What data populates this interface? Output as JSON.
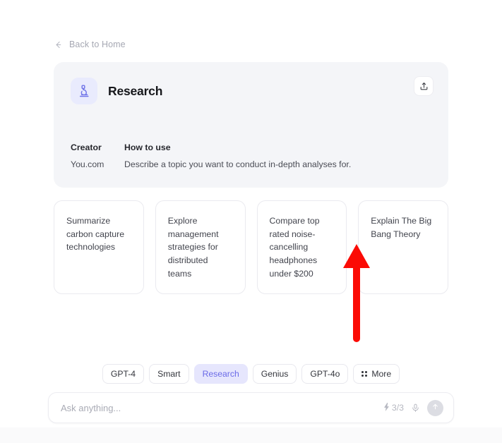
{
  "nav": {
    "back_label": "Back to Home",
    "back_icon": "arrow-left-icon"
  },
  "header": {
    "title": "Research",
    "app_icon": "microscope-icon",
    "share_icon": "share-upload-icon",
    "icon_bg": "#e9ebfd",
    "icon_color": "#6f73e8",
    "card_bg": "#f4f5f8"
  },
  "meta": {
    "creator_label": "Creator",
    "creator_value": "You.com",
    "howto_label": "How to use",
    "howto_value": "Describe a topic you want to conduct in-depth analyses for."
  },
  "suggestions": [
    {
      "text": "Summarize carbon capture technologies"
    },
    {
      "text": "Explore management strategies for distributed teams"
    },
    {
      "text": "Compare top rated noise-cancelling headphones under $200"
    },
    {
      "text": "Explain The Big Bang Theory"
    }
  ],
  "annotation": {
    "type": "arrow-up",
    "color": "#fb0b05"
  },
  "modes": [
    {
      "label": "GPT-4",
      "active": false
    },
    {
      "label": "Smart",
      "active": false
    },
    {
      "label": "Research",
      "active": true
    },
    {
      "label": "Genius",
      "active": false
    },
    {
      "label": "GPT-4o",
      "active": false
    }
  ],
  "more": {
    "label": "More",
    "icon": "dot-grid-icon"
  },
  "composer": {
    "placeholder": "Ask anything...",
    "quota": "3/3",
    "quota_icon": "lightning-bolt-icon",
    "mic_icon": "microphone-icon",
    "send_icon": "arrow-up-circle-icon",
    "accent": "#6b6be8",
    "active_pill_bg": "#e6e6fd"
  }
}
